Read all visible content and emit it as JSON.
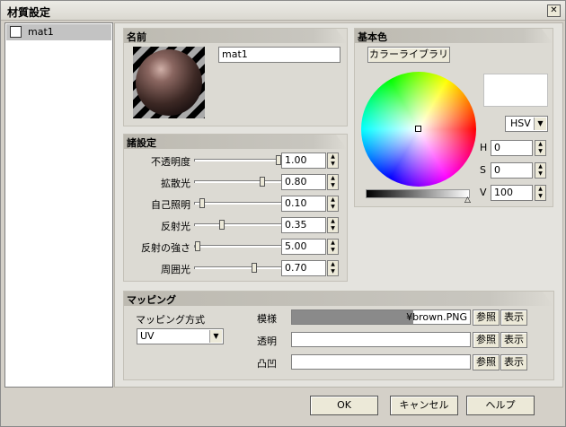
{
  "window": {
    "title": "材質設定",
    "close_symbol": "✕"
  },
  "materials": [
    {
      "name": "mat1",
      "checked": false
    }
  ],
  "name_group": {
    "title": "名前",
    "name_value": "mat1"
  },
  "settings": {
    "title": "諸設定",
    "rows": [
      {
        "label": "不透明度",
        "value": "1.00",
        "level": 1.0
      },
      {
        "label": "拡散光",
        "value": "0.80",
        "level": 0.8
      },
      {
        "label": "自己照明",
        "value": "0.10",
        "level": 0.05
      },
      {
        "label": "反射光",
        "value": "0.35",
        "level": 0.3
      },
      {
        "label": "反射の強さ",
        "value": "5.00",
        "level": 0.0
      },
      {
        "label": "周囲光",
        "value": "0.70",
        "level": 0.7
      }
    ]
  },
  "base_color": {
    "title": "基本色",
    "library_button": "カラーライブラリ",
    "mode": "HSV",
    "h_label": "H",
    "h_value": "0",
    "s_label": "S",
    "s_value": "0",
    "v_label": "V",
    "v_value": "100",
    "swatch_color": "#ffffff"
  },
  "mapping": {
    "title": "マッピング",
    "method_label": "マッピング方式",
    "method_value": "UV",
    "rows": [
      {
        "label": "模様",
        "path": "¥brown.PNG",
        "browse": "参照",
        "show": "表示"
      },
      {
        "label": "透明",
        "path": "",
        "browse": "参照",
        "show": "表示"
      },
      {
        "label": "凸凹",
        "path": "",
        "browse": "参照",
        "show": "表示"
      }
    ]
  },
  "buttons": {
    "ok": "OK",
    "cancel": "キャンセル",
    "help": "ヘルプ"
  }
}
